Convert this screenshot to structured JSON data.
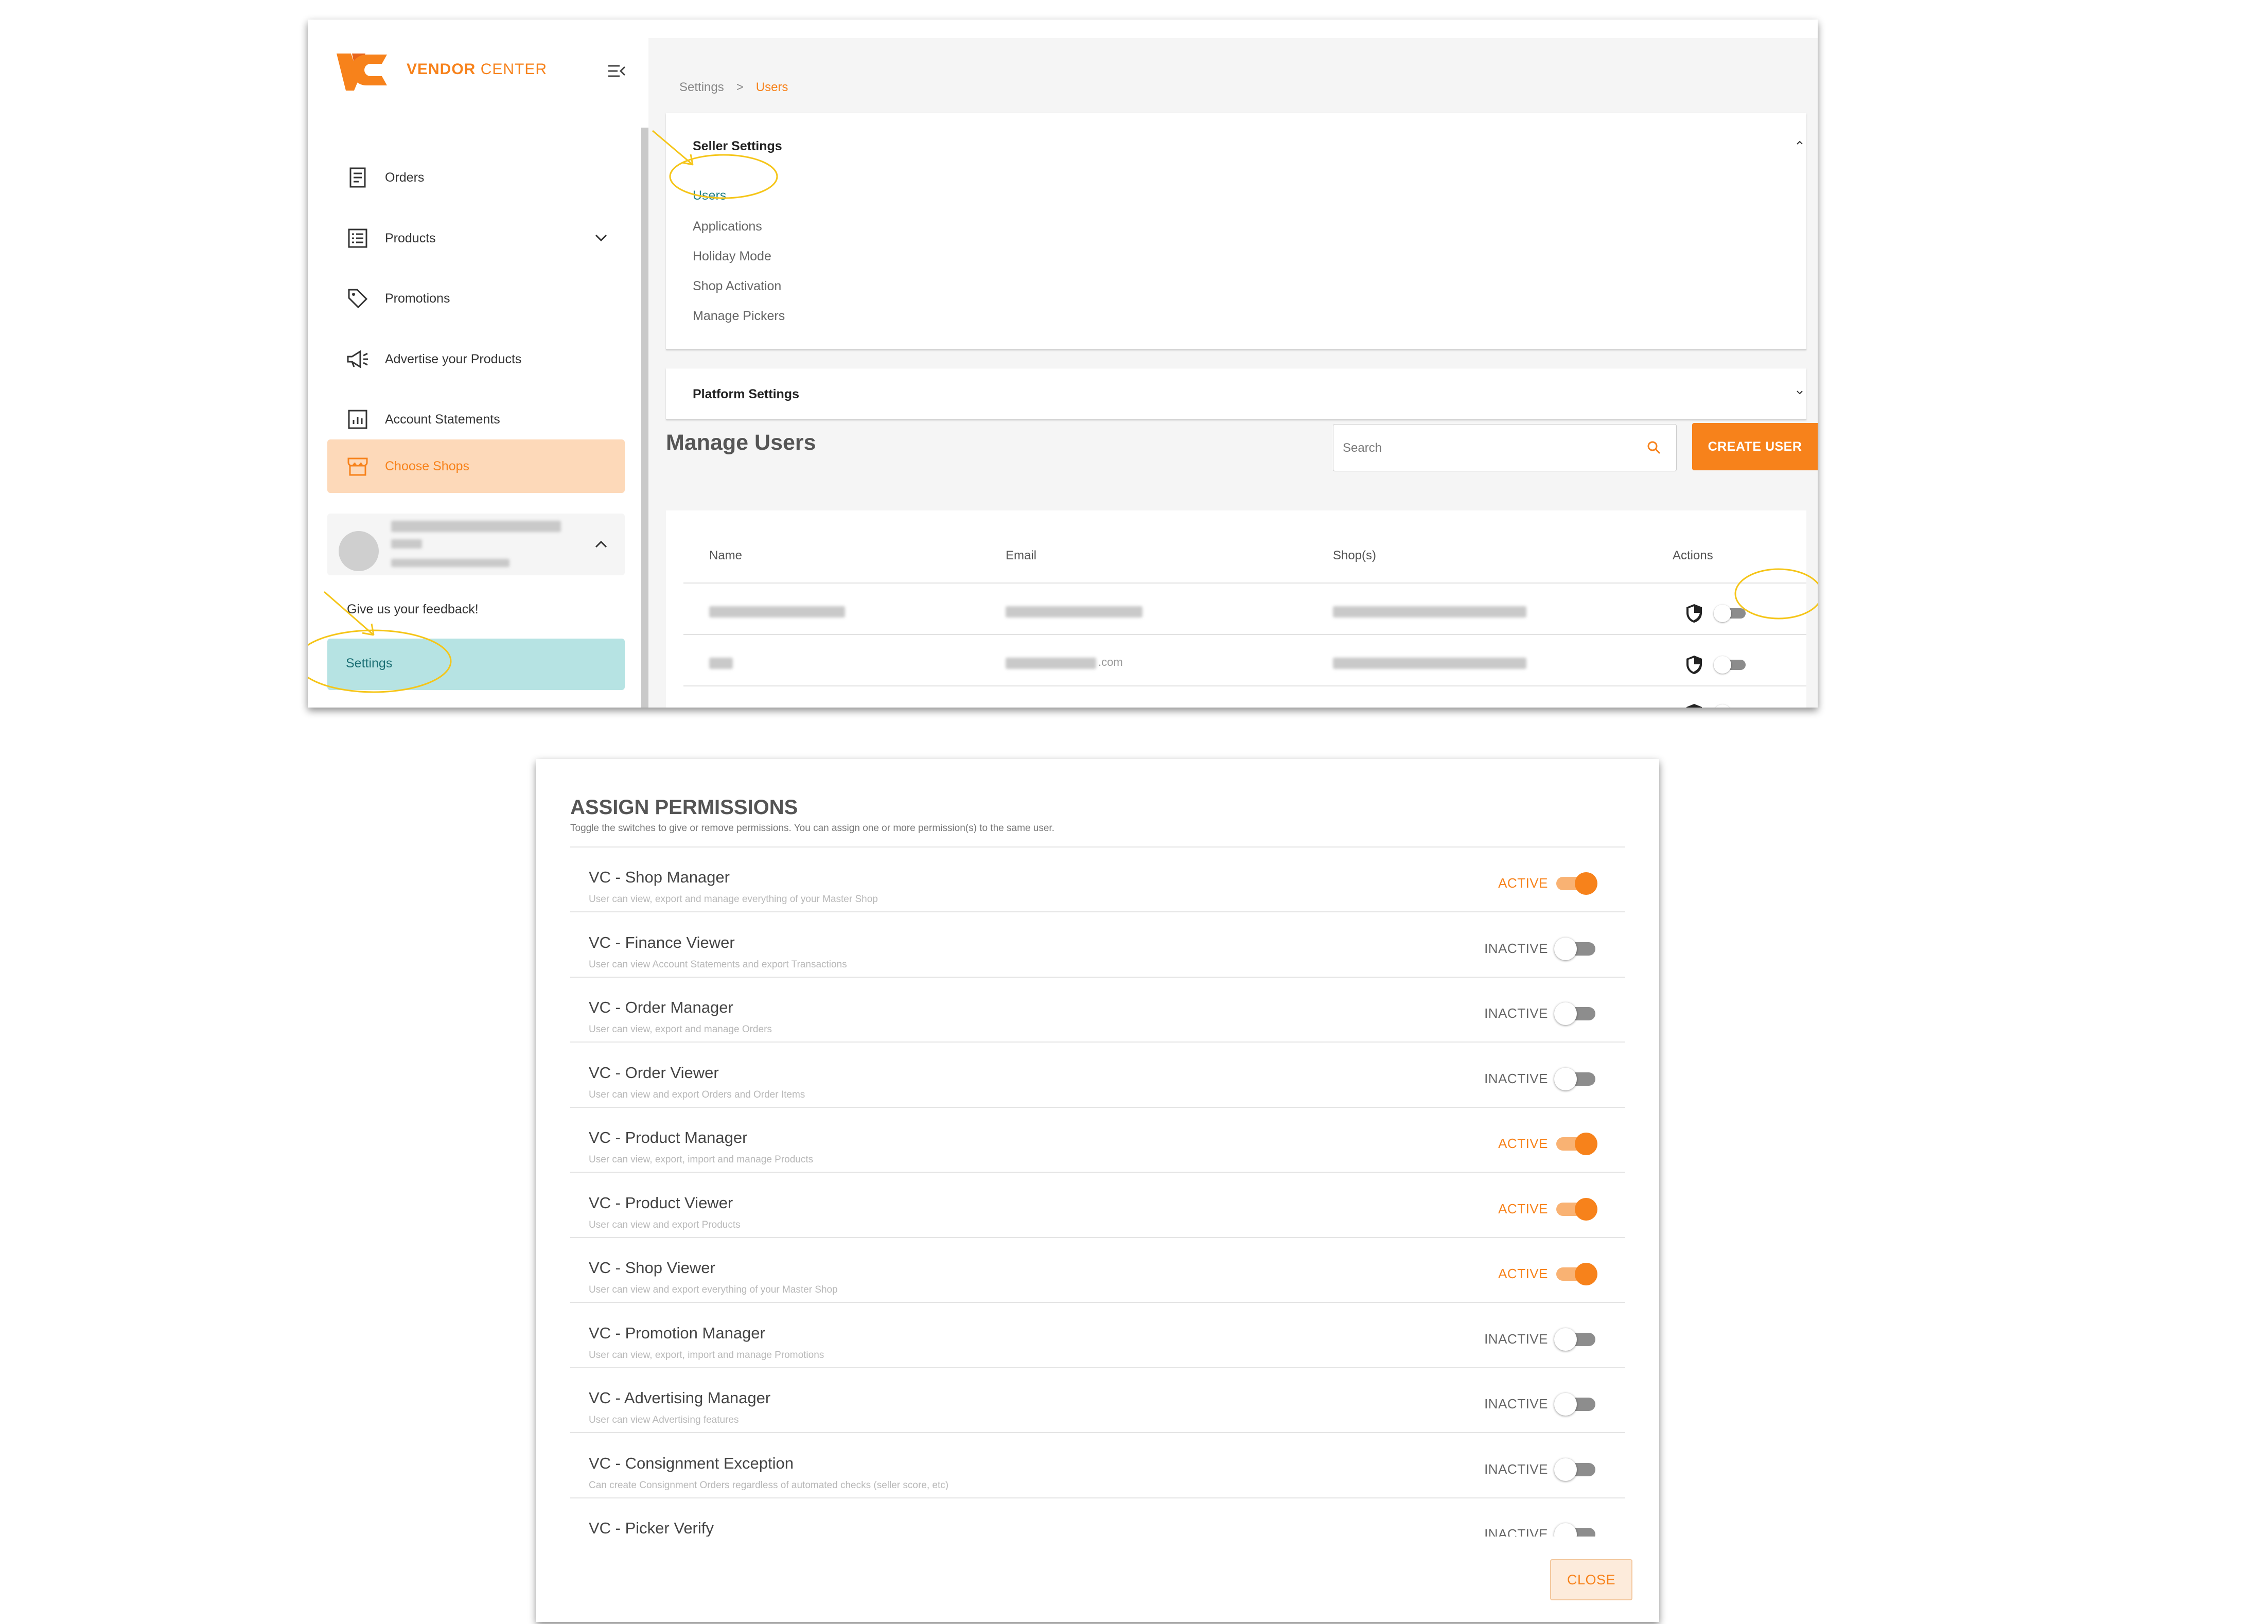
{
  "brand": {
    "name_bold": "VENDOR",
    "name_light": "CENTER",
    "logo_icon": "vc-logo",
    "accent": "#f7821b"
  },
  "sidebar": {
    "items": [
      {
        "label": "Orders",
        "icon": "receipt-icon"
      },
      {
        "label": "Products",
        "icon": "list-icon"
      },
      {
        "label": "Promotions",
        "icon": "tag-icon"
      },
      {
        "label": "Advertise your Products",
        "icon": "megaphone-icon"
      },
      {
        "label": "Account Statements",
        "icon": "chart-icon"
      }
    ],
    "choose_shops": "Choose Shops",
    "feedback": "Give us your feedback!",
    "settings": "Settings"
  },
  "breadcrumb": {
    "parent": "Settings",
    "separator": ">",
    "current": "Users"
  },
  "seller_settings": {
    "title": "Seller Settings",
    "links": [
      "Users",
      "Applications",
      "Holiday Mode",
      "Shop Activation",
      "Manage Pickers"
    ]
  },
  "platform_settings": {
    "title": "Platform Settings"
  },
  "manage_users": {
    "title": "Manage Users",
    "search_placeholder": "Search",
    "create_button": "CREATE USER",
    "columns": [
      "Name",
      "Email",
      "Shop(s)",
      "Actions"
    ],
    "row2_email_suffix": ".com"
  },
  "permissions": {
    "title": "ASSIGN PERMISSIONS",
    "subtitle": "Toggle the switches to give or remove permissions. You can assign one or more permission(s) to the same user.",
    "active_label": "ACTIVE",
    "inactive_label": "INACTIVE",
    "items": [
      {
        "name": "VC - Shop Manager",
        "desc": "User can view, export and manage everything of your Master Shop",
        "active": true
      },
      {
        "name": "VC - Finance Viewer",
        "desc": "User can view Account Statements and export Transactions",
        "active": false
      },
      {
        "name": "VC - Order Manager",
        "desc": "User can view, export and manage Orders",
        "active": false
      },
      {
        "name": "VC - Order Viewer",
        "desc": "User can view and export Orders and Order Items",
        "active": false
      },
      {
        "name": "VC - Product Manager",
        "desc": "User can view, export, import and manage Products",
        "active": true
      },
      {
        "name": "VC - Product Viewer",
        "desc": "User can view and export Products",
        "active": true
      },
      {
        "name": "VC - Shop Viewer",
        "desc": "User can view and export everything of your Master Shop",
        "active": true
      },
      {
        "name": "VC - Promotion Manager",
        "desc": "User can view, export, import and manage Promotions",
        "active": false
      },
      {
        "name": "VC - Advertising Manager",
        "desc": "User can view Advertising features",
        "active": false
      },
      {
        "name": "VC - Consignment Exception",
        "desc": "Can create Consignment Orders regardless of automated checks (seller score, etc)",
        "active": false
      },
      {
        "name": "VC - Picker Verify",
        "desc": "",
        "active": false
      }
    ],
    "close_button": "CLOSE"
  }
}
